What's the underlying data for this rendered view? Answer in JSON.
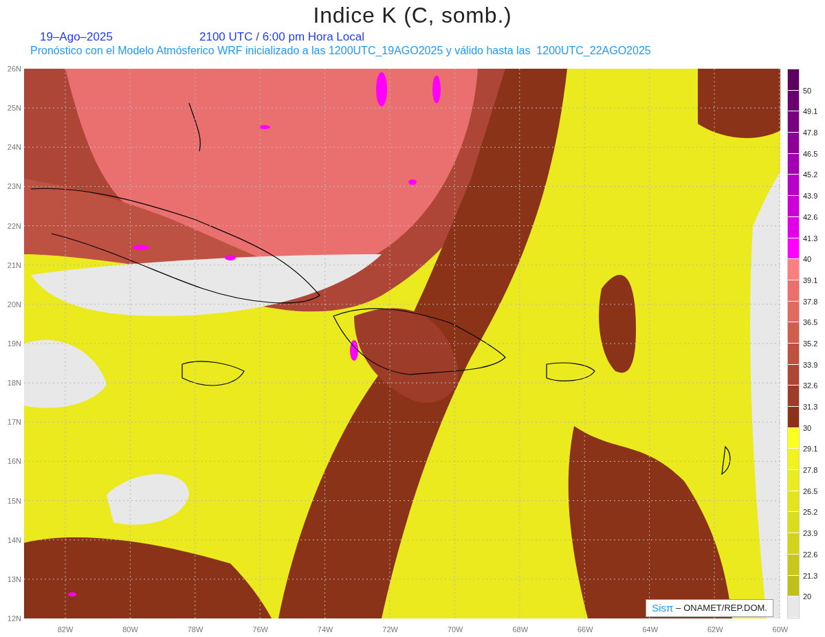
{
  "title": "Indice K (C, somb.)",
  "date": "19–Ago–2025",
  "time": "2100 UTC / 6:00 pm Hora Local",
  "subtitle": "Pronóstico con el Modelo Atmósferico WRF inicializado a las 1200UTC_19AGO2025 y válido hasta las  1200UTC_22AGO2025",
  "lat_labels": [
    "26N",
    "25N",
    "24N",
    "23N",
    "22N",
    "21N",
    "20N",
    "19N",
    "18N",
    "17N",
    "16N",
    "15N",
    "14N",
    "13N",
    "12N"
  ],
  "lon_labels": [
    "82W",
    "80W",
    "78W",
    "76W",
    "74W",
    "72W",
    "70W",
    "68W",
    "66W",
    "64W",
    "62W",
    "60W"
  ],
  "colorbar": [
    {
      "color": "#5a005e",
      "label": "50"
    },
    {
      "color": "#68006e",
      "label": "49.1"
    },
    {
      "color": "#78007e",
      "label": "47.8"
    },
    {
      "color": "#8c0096",
      "label": "46.5"
    },
    {
      "color": "#a000ae",
      "label": "45.2"
    },
    {
      "color": "#b800c6",
      "label": "43.9"
    },
    {
      "color": "#cc00d6",
      "label": "42.6"
    },
    {
      "color": "#e000e6",
      "label": "41.3"
    },
    {
      "color": "#ff00ff",
      "label": "40"
    },
    {
      "color": "#f88080",
      "label": "39.1"
    },
    {
      "color": "#ea7070",
      "label": "37.8"
    },
    {
      "color": "#de6a60",
      "label": "36.5"
    },
    {
      "color": "#ce5e50",
      "label": "35.2"
    },
    {
      "color": "#be5242",
      "label": "33.9"
    },
    {
      "color": "#ad4636",
      "label": "32.6"
    },
    {
      "color": "#9e3c2a",
      "label": "31.3"
    },
    {
      "color": "#8b3318",
      "label": "30"
    },
    {
      "color": "#ffff20",
      "label": "29.1"
    },
    {
      "color": "#f2f220",
      "label": "27.8"
    },
    {
      "color": "#ebeb20",
      "label": "26.5"
    },
    {
      "color": "#e4e41e",
      "label": "25.2"
    },
    {
      "color": "#dcdc1e",
      "label": "23.9"
    },
    {
      "color": "#d3d31e",
      "label": "22.6"
    },
    {
      "color": "#c8c81c",
      "label": "21.3"
    },
    {
      "color": "#c0c018",
      "label": "20"
    },
    {
      "color": "#e8e8e8"
    }
  ],
  "credit": {
    "logo": "Sisπ",
    "text": "– ONAMET/REP.DOM."
  }
}
